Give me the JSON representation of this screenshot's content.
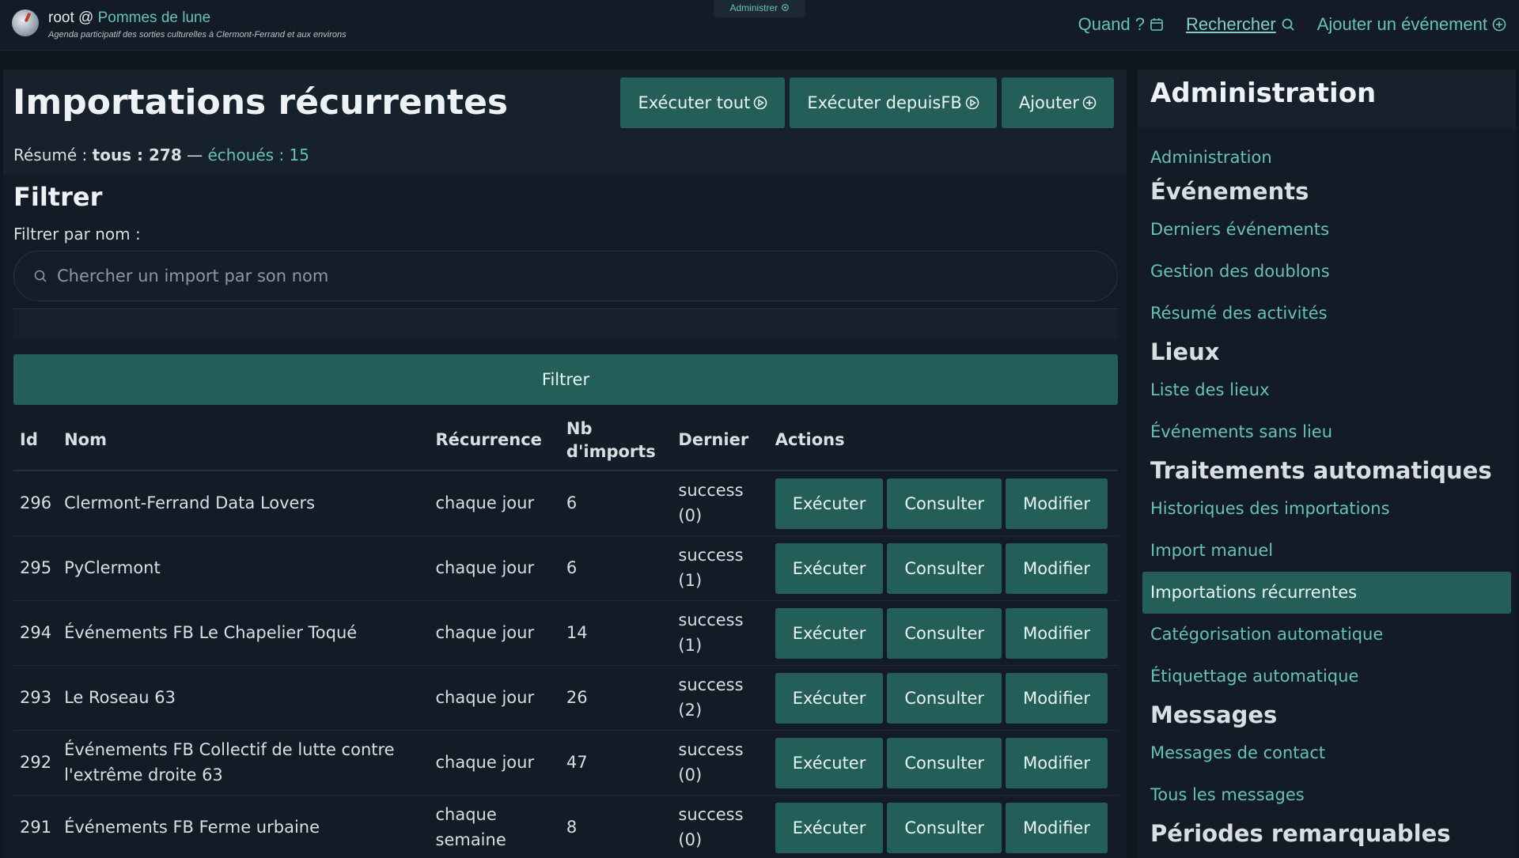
{
  "header": {
    "user": "root @",
    "brand": "Pommes de lune",
    "tagline": "Agenda participatif des sorties culturelles à Clermont-Ferrand et aux environs",
    "admin_pill": "Administrer",
    "nav": {
      "when": "Quand ?",
      "search": "Rechercher",
      "add_event": "Ajouter un événement"
    }
  },
  "main": {
    "title": "Importations récurrentes",
    "buttons": {
      "run_all": "Exécuter tout",
      "run_fb": "Exécuter depuisFB",
      "add": "Ajouter"
    },
    "summary": {
      "label": "Résumé :",
      "all": "tous : 278",
      "separator": "—",
      "failed": "échoués : 15"
    },
    "filter": {
      "title": "Filtrer",
      "label": "Filtrer par nom :",
      "placeholder": "Chercher un import par son nom",
      "button": "Filtrer"
    },
    "table": {
      "headers": [
        "Id",
        "Nom",
        "Récurrence",
        "Nb d'imports",
        "Dernier",
        "Actions"
      ],
      "action_labels": {
        "run": "Exécuter",
        "view": "Consulter",
        "edit": "Modifier"
      },
      "rows": [
        {
          "id": "296",
          "name": "Clermont-Ferrand Data Lovers",
          "recurrence": "chaque jour",
          "count": "6",
          "last": "success (0)"
        },
        {
          "id": "295",
          "name": "PyClermont",
          "recurrence": "chaque jour",
          "count": "6",
          "last": "success (1)"
        },
        {
          "id": "294",
          "name": "Événements FB Le Chapelier Toqué",
          "recurrence": "chaque jour",
          "count": "14",
          "last": "success (1)"
        },
        {
          "id": "293",
          "name": "Le Roseau 63",
          "recurrence": "chaque jour",
          "count": "26",
          "last": "success (2)"
        },
        {
          "id": "292",
          "name": "Événements FB Collectif de lutte contre l'extrême droite 63",
          "recurrence": "chaque jour",
          "count": "47",
          "last": "success (0)"
        },
        {
          "id": "291",
          "name": "Événements FB Ferme urbaine",
          "recurrence": "chaque semaine",
          "count": "8",
          "last": "success (0)"
        }
      ]
    }
  },
  "sidebar": {
    "title": "Administration",
    "items": [
      {
        "type": "link",
        "label": "Administration"
      },
      {
        "type": "section",
        "label": "Événements"
      },
      {
        "type": "link",
        "label": "Derniers événements"
      },
      {
        "type": "link",
        "label": "Gestion des doublons"
      },
      {
        "type": "link",
        "label": "Résumé des activités"
      },
      {
        "type": "section",
        "label": "Lieux"
      },
      {
        "type": "link",
        "label": "Liste des lieux"
      },
      {
        "type": "link",
        "label": "Événements sans lieu"
      },
      {
        "type": "section",
        "label": "Traitements automatiques"
      },
      {
        "type": "link",
        "label": "Historiques des importations"
      },
      {
        "type": "link",
        "label": "Import manuel"
      },
      {
        "type": "link",
        "label": "Importations récurrentes",
        "active": true
      },
      {
        "type": "link",
        "label": "Catégorisation automatique"
      },
      {
        "type": "link",
        "label": "Étiquettage automatique"
      },
      {
        "type": "section",
        "label": "Messages"
      },
      {
        "type": "link",
        "label": "Messages de contact"
      },
      {
        "type": "link",
        "label": "Tous les messages"
      },
      {
        "type": "section",
        "label": "Périodes remarquables"
      }
    ]
  },
  "colors": {
    "accent": "#235f58",
    "link": "#66c2b3",
    "background": "#0f1720",
    "panel": "#131c26"
  }
}
